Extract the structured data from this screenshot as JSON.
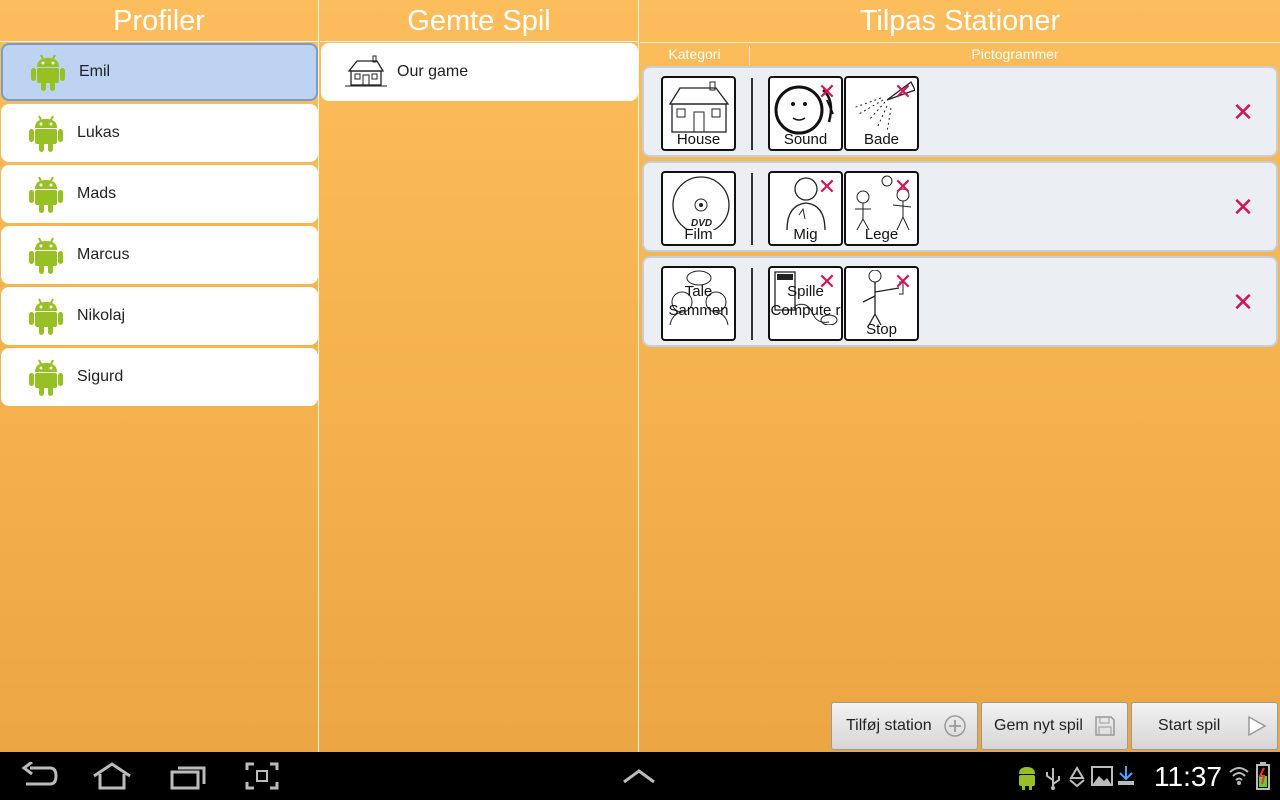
{
  "profiles": {
    "title": "Profiler",
    "items": [
      {
        "name": "Emil",
        "selected": true
      },
      {
        "name": "Lukas",
        "selected": false
      },
      {
        "name": "Mads",
        "selected": false
      },
      {
        "name": "Marcus",
        "selected": false
      },
      {
        "name": "Nikolaj",
        "selected": false
      },
      {
        "name": "Sigurd",
        "selected": false
      }
    ]
  },
  "saved_games": {
    "title": "Gemte Spil",
    "items": [
      {
        "name": "Our game",
        "icon": "house-icon"
      }
    ]
  },
  "stations": {
    "title": "Tilpas Stationer",
    "category_header": "Kategori",
    "pictogram_header": "Pictogrammer",
    "rows": [
      {
        "category": "House",
        "category_icon": "house-icon",
        "pictograms": [
          {
            "label": "Sound",
            "icon": "sound-face-icon"
          },
          {
            "label": "Bade",
            "icon": "shower-icon"
          }
        ]
      },
      {
        "category": "Film",
        "category_icon": "dvd-icon",
        "pictograms": [
          {
            "label": "Mig",
            "icon": "person-icon"
          },
          {
            "label": "Lege",
            "icon": "children-playing-icon"
          }
        ]
      },
      {
        "category": "Tale Sammen",
        "category_icon": "two-people-talking-icon",
        "pictograms": [
          {
            "label": "Spille Compute r",
            "icon": "computer-game-icon"
          },
          {
            "label": "Stop",
            "icon": "stop-hand-icon"
          }
        ]
      }
    ]
  },
  "actions": {
    "add_station": "Tilføj station",
    "save_game": "Gem nyt spil",
    "start_game": "Start spil"
  },
  "system_bar": {
    "clock": "11:37"
  },
  "colors": {
    "accent_delete": "#d4145a",
    "selected_row": "#bcd4f2",
    "background_top": "#fcbd5c",
    "background_bottom": "#eaa542",
    "android_green": "#97c024"
  }
}
